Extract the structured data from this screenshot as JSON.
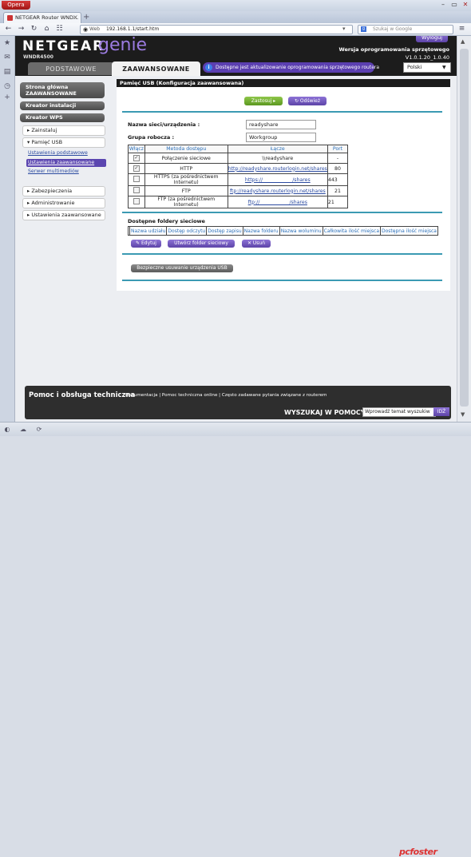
{
  "browser": {
    "menu_label": "Opera",
    "tab_title": "NETGEAR Router WND...",
    "address_mode": "Web",
    "url": "192.168.1.1/start.htm",
    "search_placeholder": "Szukaj w Google",
    "search_engine_icon": "google-icon",
    "watermark": "pcfoster"
  },
  "header": {
    "brand": "NETGEAR",
    "product": "genie",
    "model": "WNDR4500",
    "logout_label": "Wyloguj",
    "firmware_label": "Wersja oprogramowania sprzętowego",
    "firmware_version": "V1.0.1.20_1.0.40",
    "tab_basic": "PODSTAWOWE",
    "tab_advanced": "ZAAWANSOWANE",
    "update_notice": "Dostępne jest aktualizowanie oprogramowania sprzętowego routera",
    "language": "Polski"
  },
  "sidebar": {
    "home": "Strona główna ZAAWANSOWANE",
    "setup_wizard": "Kreator instalacji",
    "wps_wizard": "Kreator WPS",
    "setup": "Zainstaluj",
    "usb_storage": "Pamięć USB",
    "usb_sub": [
      "Ustawienia podstawowe",
      "Ustawienia zaawansowane",
      "Serwer multimediów"
    ],
    "security": "Zabezpieczenia",
    "administration": "Administrowanie",
    "advanced_setup": "Ustawienia zaawansowane"
  },
  "main": {
    "title": "Pamięć USB (Konfiguracja zaawansowana)",
    "apply_label": "Zastosuj ▸",
    "refresh_label": "Odśwież",
    "device_name_label": "Nazwa sieci/urządzenia :",
    "device_name_value": "readyshare",
    "workgroup_label": "Grupa robocza :",
    "workgroup_value": "Workgroup",
    "shares_headers": [
      "Włącz",
      "Metoda dostępu",
      "Łącze",
      "Port"
    ],
    "shares_rows": [
      {
        "enabled": true,
        "method": "Połączenie sieciowe",
        "link": "\\\\readyshare",
        "port": "-"
      },
      {
        "enabled": true,
        "method": "HTTP",
        "link": "http://readyshare.routerlogin.net/shares",
        "port": "80"
      },
      {
        "enabled": false,
        "method": "HTTPS (za pośrednictwem Internetu)",
        "link": "https://____________/shares",
        "port": "443"
      },
      {
        "enabled": false,
        "method": "FTP",
        "link": "ftp://readyshare.routerlogin.net/shares",
        "port": "21"
      },
      {
        "enabled": false,
        "method": "FTP (za pośrednictwem Internetu)",
        "link": "ftp://____________/shares",
        "port": "21"
      }
    ],
    "folders_title": "Dostępne foldery sieciowe",
    "folders_headers": [
      "Nazwa udziału",
      "Dostęp odczytu",
      "Dostęp zapisu",
      "Nazwa folderu",
      "Nazwa woluminu",
      "Całkowita ilość miejsca",
      "Dostępna ilość miejsca"
    ],
    "edit_label": "Edytuj",
    "create_label": "Utwórz folder sieciowy",
    "delete_label": "Usuń",
    "safe_remove_label": "Bezpieczne usuwanie urządzenia USB"
  },
  "footer": {
    "title": "Pomoc i obsługa techniczna",
    "links": "Dokumentacja | Pomoc techniczna online | Często zadawane pytania związane z routerem",
    "search_label": "WYSZUKAJ W POMOCY",
    "search_placeholder": "Wprowadź temat wyszukiw",
    "go_label": "IDŹ"
  }
}
